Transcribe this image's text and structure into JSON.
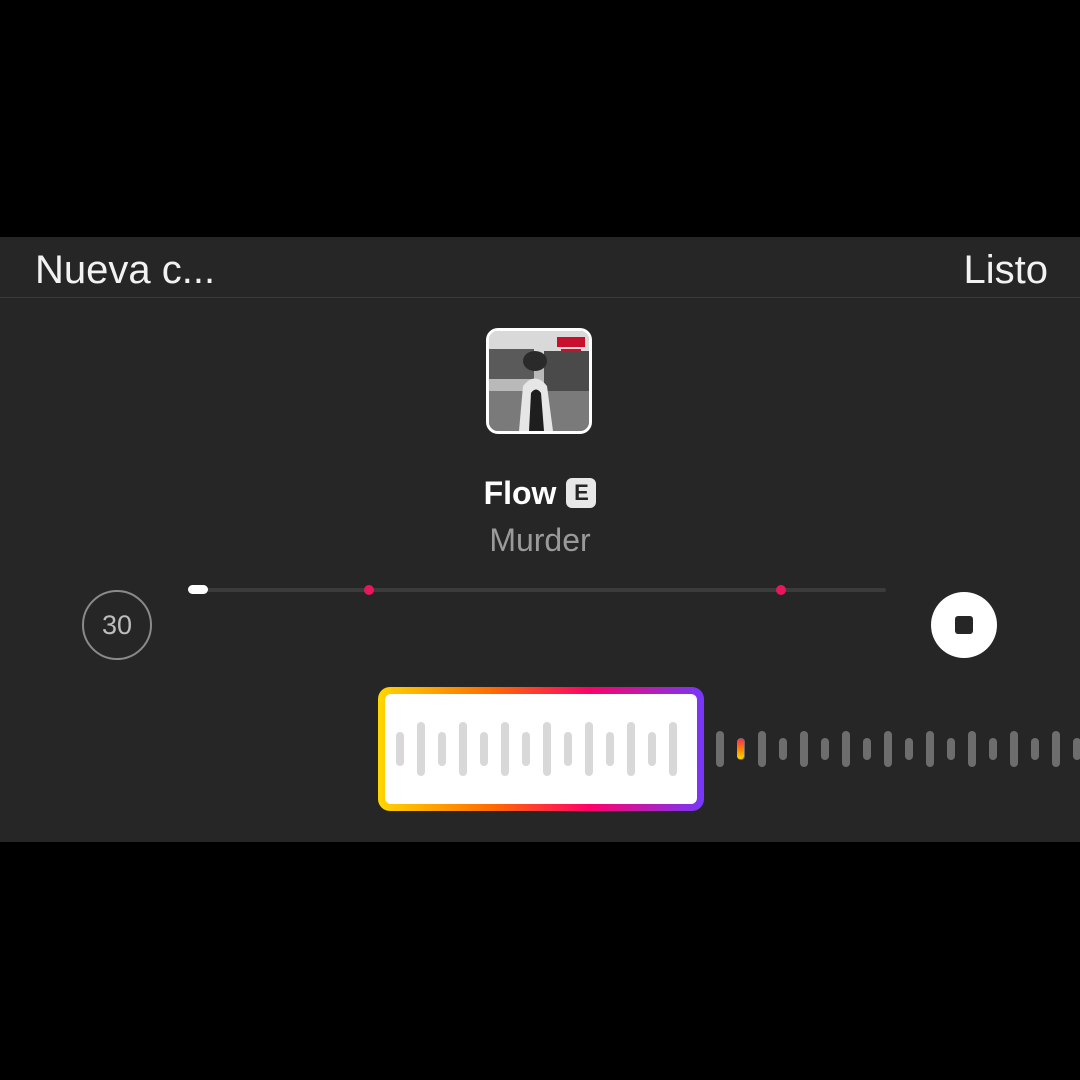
{
  "header": {
    "title": "Nueva c...",
    "done_label": "Listo"
  },
  "track": {
    "cover_icon": "album-cover-image",
    "title": "Flow",
    "explicit_badge": "E",
    "artist": "Murder"
  },
  "controls": {
    "duration_label": "30",
    "stop_icon": "stop-icon",
    "timeline_progress": 0.0,
    "timeline_markers": [
      0.26,
      0.85
    ],
    "accent_color": "#e8175d"
  },
  "waveform": {
    "selection_gradient": [
      "#ffd600",
      "#ff6a00",
      "#ff0069",
      "#7638fa"
    ]
  }
}
